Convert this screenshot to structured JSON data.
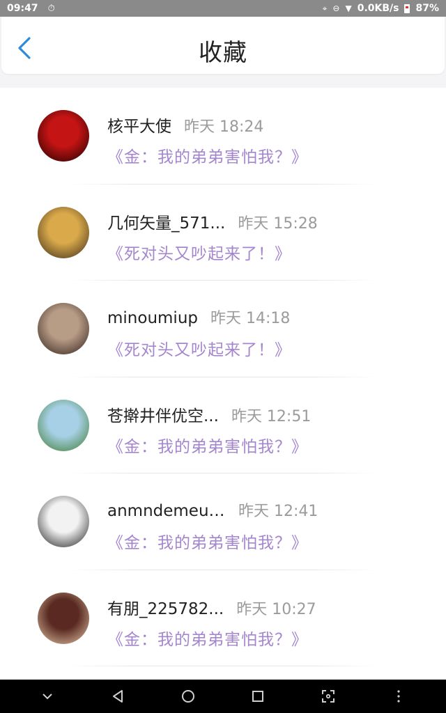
{
  "status_bar": {
    "time": "09:47",
    "network_speed": "0.0KB/s",
    "battery": "87%"
  },
  "header": {
    "title": "收藏"
  },
  "items": [
    {
      "name": "核平大使",
      "time": "昨天 18:24",
      "quote": "《金：我的弟弟害怕我？》",
      "avatar_colors": [
        "#c41414",
        "#1a0000"
      ]
    },
    {
      "name": "几何矢量_571...",
      "time": "昨天 15:28",
      "quote": "《死对头又吵起来了！》",
      "avatar_colors": [
        "#d9a94a",
        "#3a2a1a"
      ]
    },
    {
      "name": "minoumiup",
      "time": "昨天 14:18",
      "quote": "《死对头又吵起来了！》",
      "avatar_colors": [
        "#b79c86",
        "#2e1d16"
      ]
    },
    {
      "name": "苍擀井伴优空...",
      "time": "昨天 12:51",
      "quote": "《金：我的弟弟害怕我？》",
      "avatar_colors": [
        "#a7d0e6",
        "#3c7a2c"
      ]
    },
    {
      "name": "anmndemeul...",
      "time": "昨天 12:41",
      "quote": "《金：我的弟弟害怕我？》",
      "avatar_colors": [
        "#f2f2f2",
        "#1a1a1a"
      ]
    },
    {
      "name": "有朋_225782...",
      "time": "昨天 10:27",
      "quote": "《金：我的弟弟害怕我？》",
      "avatar_colors": [
        "#5a2a22",
        "#e6c9a8"
      ]
    }
  ],
  "colors": {
    "accent": "#2e8bdb",
    "quote": "#a486cf",
    "time": "#9b9b9b"
  }
}
